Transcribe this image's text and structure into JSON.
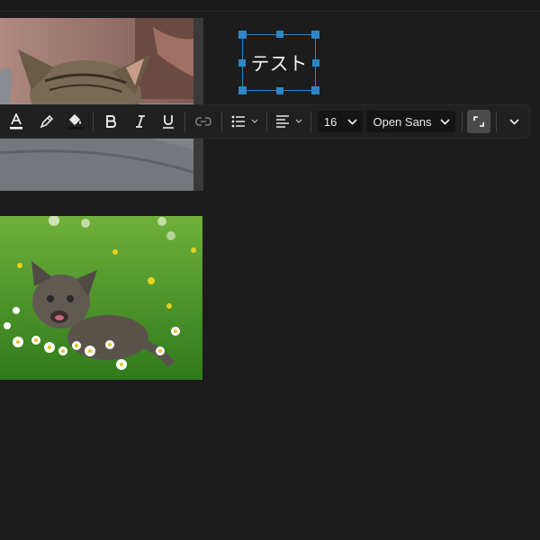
{
  "canvas": {
    "text_box": {
      "text": "テスト"
    },
    "photos": [
      {
        "subject": "sleeping tabby kitten on grey blanket"
      },
      {
        "subject": "tabby kitten in grass with daisies"
      }
    ]
  },
  "toolbar": {
    "font_size": "16",
    "font_family": "Open Sans",
    "buttons": [
      "text-color",
      "highlight",
      "fill-color",
      "bold",
      "italic",
      "underline",
      "link",
      "bulleted-list",
      "align",
      "expand",
      "more"
    ]
  },
  "colors": {
    "background": "#1c1c1c",
    "toolbar": "#202020",
    "selection": "#2f86c4",
    "active_button": "#4a4a4a"
  }
}
